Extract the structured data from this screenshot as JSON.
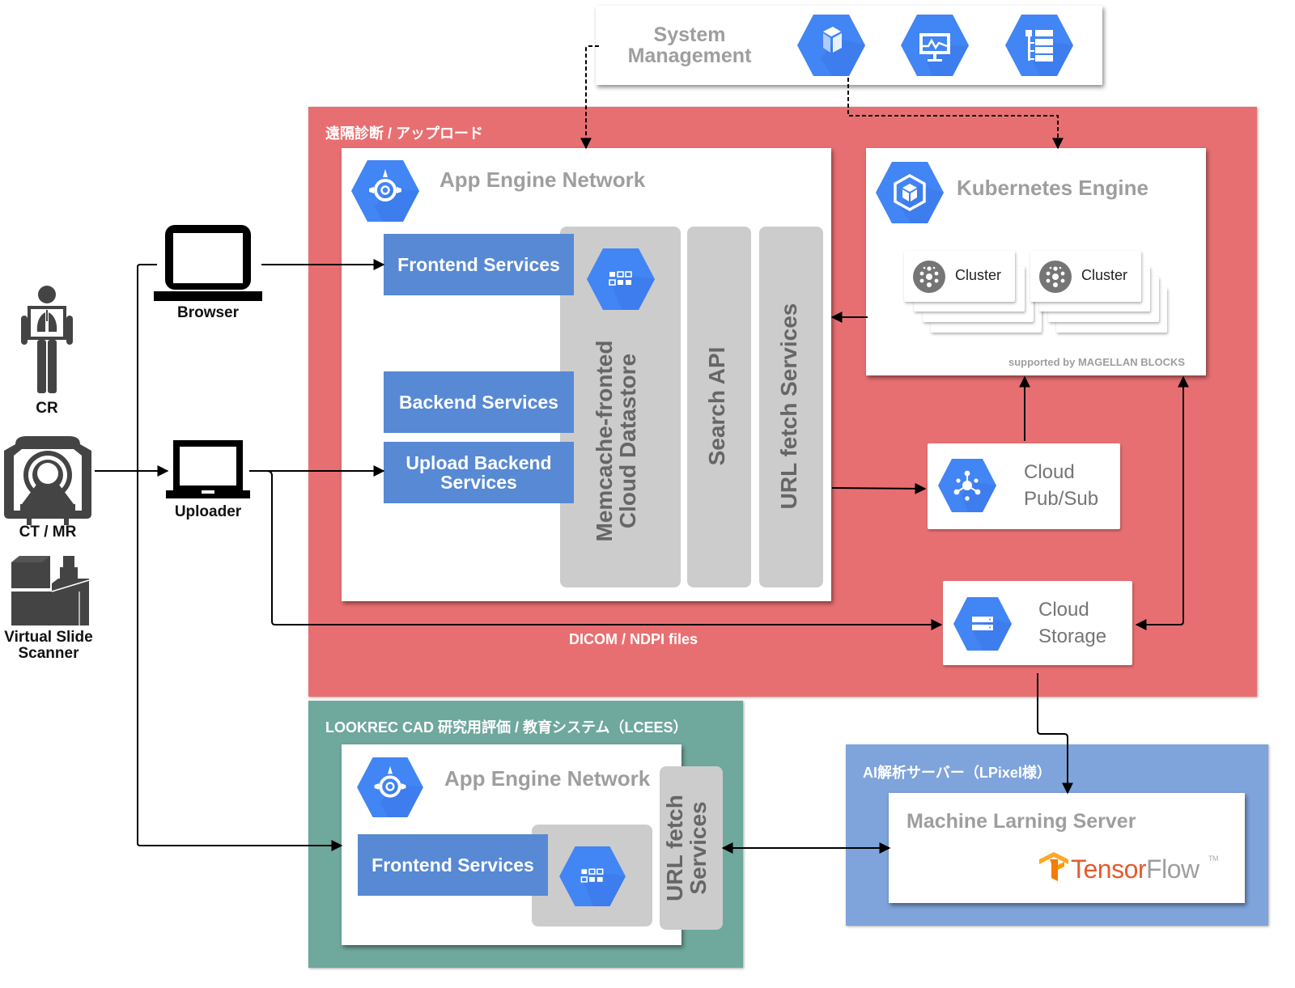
{
  "system_management": {
    "title_line1": "System",
    "title_line2": "Management",
    "icons": [
      "deployment-manager-icon",
      "stackdriver-monitoring-icon",
      "stackdriver-logging-icon"
    ]
  },
  "remote_zone": {
    "title": "遠隔診断 / アップロード",
    "color": "#e86f71",
    "app_engine": {
      "title": "App Engine Network",
      "frontend": "Frontend Services",
      "backend": "Backend Services",
      "upload_backend_line1": "Upload Backend",
      "upload_backend_line2": "Services",
      "datastore_line1": "Memcache-fronted",
      "datastore_line2": "Cloud Datastore",
      "search_api": "Search API",
      "url_fetch": "URL fetch Services"
    },
    "kubernetes": {
      "title": "Kubernetes Engine",
      "clusters": [
        "Cluster",
        "Cluster"
      ],
      "footnote": "supported by MAGELLAN BLOCKS"
    },
    "pubsub": {
      "line1": "Cloud",
      "line2": "Pub/Sub"
    },
    "storage": {
      "line1": "Cloud",
      "line2": "Storage"
    },
    "flow_label": "DICOM / NDPI files"
  },
  "lcees_zone": {
    "title": "LOOKREC CAD 研究用評価 / 教育システム（LCEES）",
    "color": "#6fa89d",
    "app_engine_title": "App Engine Network",
    "frontend": "Frontend Services",
    "url_fetch_line1": "URL fetch",
    "url_fetch_line2": "Services"
  },
  "ai_zone": {
    "title": "AI解析サーバー（LPixel様）",
    "color": "#7fa3db",
    "server_title": "Machine Larning Server",
    "logo_part1": "Tensor",
    "logo_part2": "Flow",
    "logo_tm": "TM"
  },
  "devices": {
    "cr": "CR",
    "ct_mr": "CT / MR",
    "scanner_line1": "Virtual Slide",
    "scanner_line2": "Scanner",
    "browser": "Browser",
    "uploader": "Uploader"
  },
  "colors": {
    "gcp_blue": "#4285f4",
    "gcp_blue_dark": "#3b78e7",
    "service_blue": "#5789d4",
    "tensorflow_orange": "#e55b2d"
  }
}
